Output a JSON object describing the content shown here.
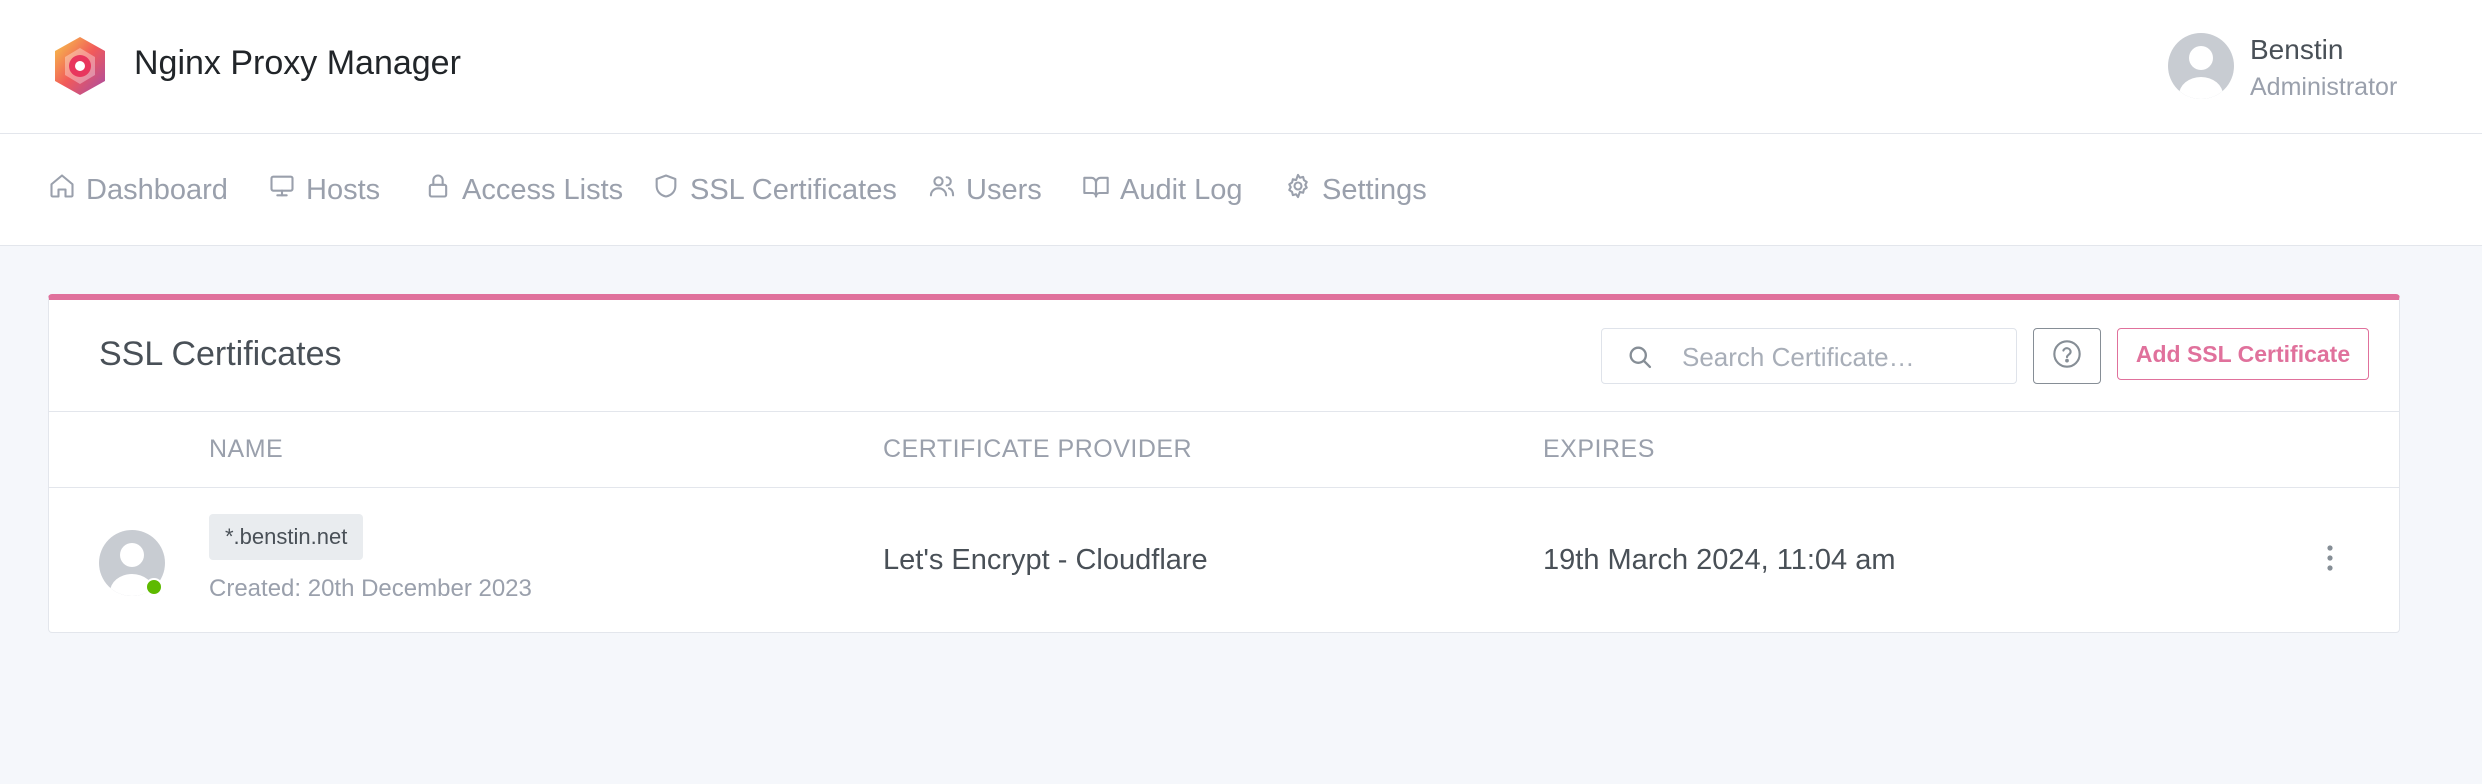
{
  "app": {
    "title": "Nginx Proxy Manager"
  },
  "user": {
    "name": "Benstin",
    "role": "Administrator"
  },
  "nav": {
    "items": [
      {
        "label": "Dashboard",
        "icon": "home-icon"
      },
      {
        "label": "Hosts",
        "icon": "monitor-icon"
      },
      {
        "label": "Access Lists",
        "icon": "lock-icon"
      },
      {
        "label": "SSL Certificates",
        "icon": "shield-icon"
      },
      {
        "label": "Users",
        "icon": "users-icon"
      },
      {
        "label": "Audit Log",
        "icon": "book-icon"
      },
      {
        "label": "Settings",
        "icon": "gear-icon"
      }
    ]
  },
  "card": {
    "title": "SSL Certificates",
    "search_placeholder": "Search Certificate…",
    "add_button_label": "Add SSL Certificate",
    "accent_color": "#e0719c"
  },
  "table": {
    "columns": [
      "NAME",
      "CERTIFICATE PROVIDER",
      "EXPIRES"
    ],
    "rows": [
      {
        "domain": "*.benstin.net",
        "created": "Created: 20th December 2023",
        "provider": "Let's Encrypt - Cloudflare",
        "expires": "19th March 2024, 11:04 am",
        "status_color": "#5eba00"
      }
    ]
  }
}
